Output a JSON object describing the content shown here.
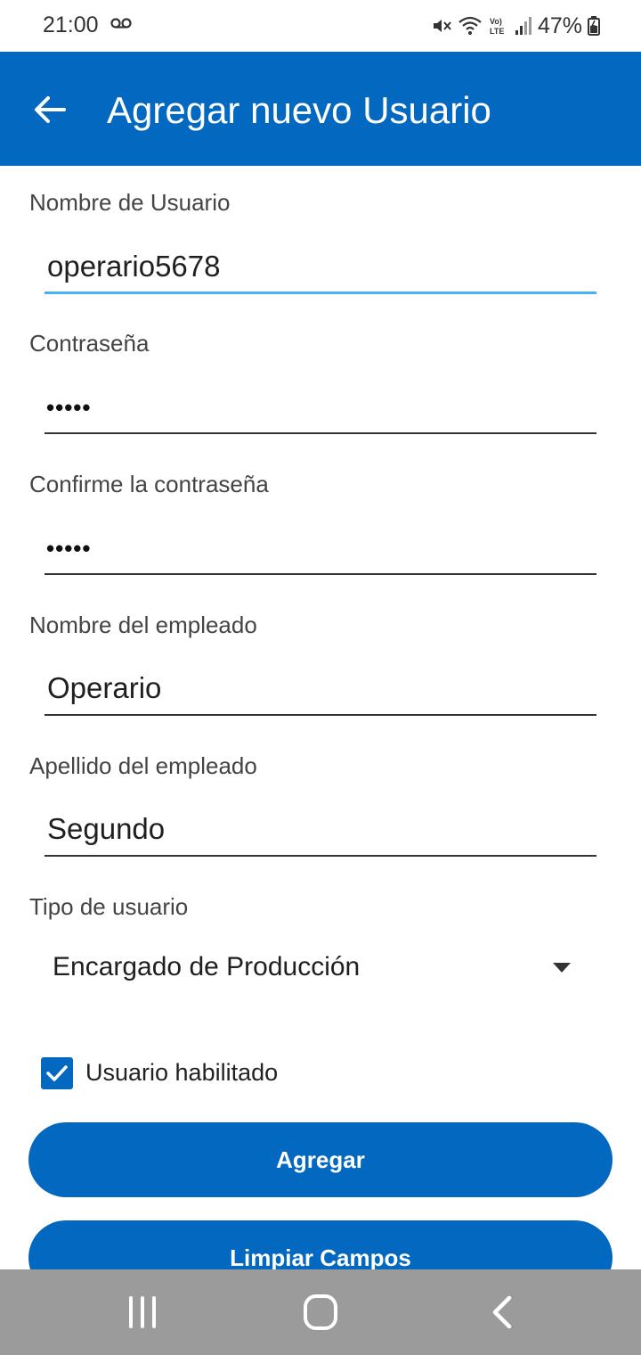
{
  "status_bar": {
    "time": "21:00",
    "battery": "47%",
    "icons": [
      "voicemail-icon",
      "mute-icon",
      "wifi-icon",
      "volte-icon",
      "signal-icon",
      "battery-icon"
    ]
  },
  "app_bar": {
    "title": "Agregar nuevo Usuario",
    "back_icon": "arrow-left-icon"
  },
  "form": {
    "username": {
      "label": "Nombre de Usuario",
      "value": "operario5678"
    },
    "password": {
      "label": "Contraseña",
      "value": "•••••"
    },
    "confirm_password": {
      "label": "Confirme la contraseña",
      "value": "•••••"
    },
    "first_name": {
      "label": "Nombre del empleado",
      "value": "Operario"
    },
    "last_name": {
      "label": "Apellido del empleado",
      "value": "Segundo"
    },
    "user_type": {
      "label": "Tipo de usuario",
      "value": "Encargado de Producción"
    },
    "enabled": {
      "label": "Usuario habilitado",
      "checked": true
    }
  },
  "buttons": {
    "add": "Agregar",
    "clear": "Limpiar Campos"
  },
  "colors": {
    "primary": "#0368bf",
    "focus_underline": "#4ab0ef",
    "nav_bar": "#9b9b9b"
  },
  "nav_bar": {
    "icons": [
      "recent-apps-icon",
      "home-icon",
      "back-nav-icon"
    ]
  }
}
